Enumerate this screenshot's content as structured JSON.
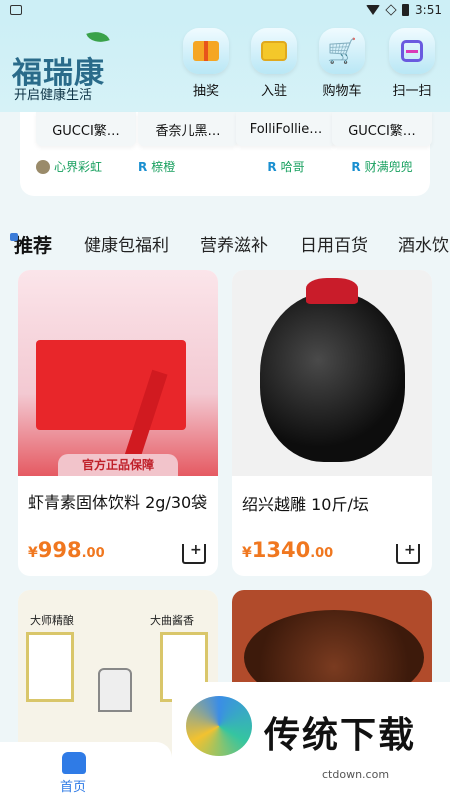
{
  "status": {
    "time": "3:51"
  },
  "header": {
    "logo": "福瑞康",
    "slogan": "开启健康生活",
    "actions": [
      {
        "label": "抽奖",
        "icon": "gift-icon"
      },
      {
        "label": "入驻",
        "icon": "shop-icon"
      },
      {
        "label": "购物车",
        "icon": "cart-icon"
      },
      {
        "label": "扫一扫",
        "icon": "scan-icon"
      }
    ]
  },
  "featured": [
    {
      "title": "GUCCI繁…",
      "seller": "心界彩虹"
    },
    {
      "title": "香奈儿黑…",
      "seller": "榇橙"
    },
    {
      "title": "FolliFollie…",
      "seller": "哈哥"
    },
    {
      "title": "GUCCI繁…",
      "seller": "财满兜兜"
    }
  ],
  "tabs": [
    "推荐",
    "健康包福利",
    "营养滋补",
    "日用百货",
    "酒水饮"
  ],
  "products": [
    {
      "title": "虾青素固体饮料 2g/30袋",
      "currency": "¥",
      "price_int": "998",
      "price_dec": ".00",
      "badge": "官方正品保障"
    },
    {
      "title": "绍兴越雕 10斤/坛",
      "currency": "¥",
      "price_int": "1340",
      "price_dec": ".00"
    },
    {
      "label_left": "大师精酿",
      "label_right": "大曲酱香"
    },
    {}
  ],
  "watermark": {
    "text": "传统下载",
    "url": "ctdown.com"
  },
  "bottom_nav": {
    "home_label": "首页"
  }
}
